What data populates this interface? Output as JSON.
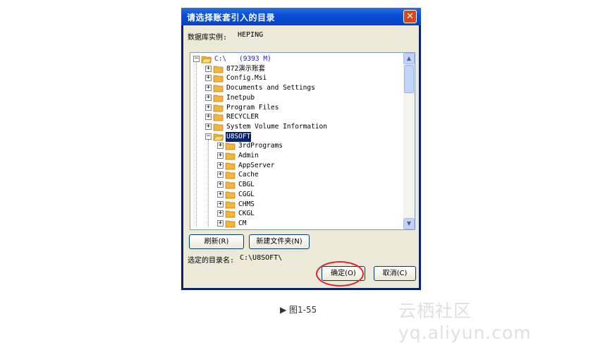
{
  "dialog": {
    "title": "请选择账套引入的目录",
    "close_glyph": "✕",
    "instance_label": "数据库实例:",
    "instance_value": "HEPING"
  },
  "tree": {
    "root": {
      "label": "C:\\",
      "size": "(9393 M)"
    },
    "items": [
      {
        "label": "872演示账套",
        "level": 1
      },
      {
        "label": "Config.Msi",
        "level": 1
      },
      {
        "label": "Documents and Settings",
        "level": 1
      },
      {
        "label": "Inetpub",
        "level": 1
      },
      {
        "label": "Program Files",
        "level": 1
      },
      {
        "label": "RECYCLER",
        "level": 1
      },
      {
        "label": "System Volume Information",
        "level": 1
      },
      {
        "label": "U8SOFT",
        "level": 1,
        "selected": true,
        "expanded": true
      },
      {
        "label": "3rdPrograms",
        "level": 2
      },
      {
        "label": "Admin",
        "level": 2
      },
      {
        "label": "AppServer",
        "level": 2
      },
      {
        "label": "Cache",
        "level": 2
      },
      {
        "label": "CBGL",
        "level": 2
      },
      {
        "label": "CGGL",
        "level": 2
      },
      {
        "label": "CHMS",
        "level": 2
      },
      {
        "label": "CKGL",
        "level": 2
      },
      {
        "label": "CM",
        "level": 2
      }
    ]
  },
  "buttons": {
    "refresh": "刷新(R)",
    "new_folder": "新建文件夹(N)",
    "ok": "确定(O)",
    "cancel": "取消(C)"
  },
  "selected_dir": {
    "label": "选定的目录名:",
    "value": "C:\\U8SOFT\\"
  },
  "caption": "▶ 图1-55",
  "watermark": "云栖社区 yq.aliyun.com",
  "colors": {
    "title_bar": "#0a4fd8",
    "selection": "#0a246a",
    "folder": "#f4b53f",
    "highlight_ring": "#e0202a"
  }
}
